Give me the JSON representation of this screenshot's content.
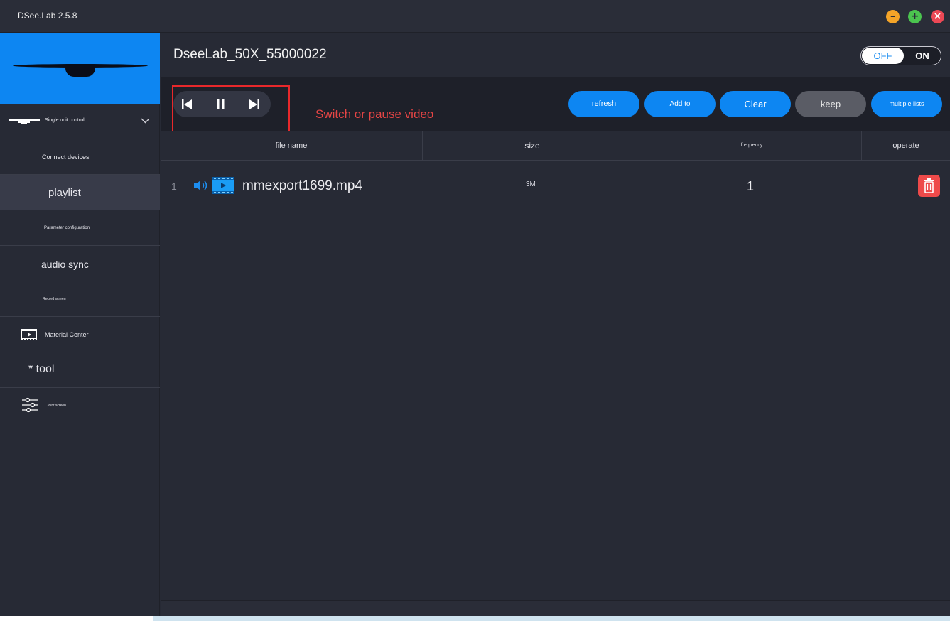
{
  "app": {
    "title": "DSee.Lab 2.5.8"
  },
  "window_controls": {
    "minimize_icon": "minimize-icon",
    "maximize_icon": "plus-icon",
    "close_icon": "close-icon"
  },
  "sidebar": {
    "section": {
      "label": "Single unit control",
      "icon": "monitor-icon",
      "chevron": "chevron-down-icon"
    },
    "items": [
      {
        "label": "Connect devices"
      },
      {
        "label": "playlist",
        "active": true
      },
      {
        "label": "Parameter configuration"
      },
      {
        "label": "audio sync"
      },
      {
        "label": "Record screen"
      },
      {
        "label": "Material Center",
        "icon": "film-icon"
      },
      {
        "label": "* tool"
      },
      {
        "label": "Joint screen",
        "icon": "sliders-icon"
      }
    ]
  },
  "header": {
    "device_name": "DseeLab_50X_55000022",
    "toggle": {
      "off_label": "OFF",
      "on_label": "ON",
      "state": "OFF"
    }
  },
  "toolbar": {
    "annotation": "Switch or pause video",
    "buttons": [
      {
        "label": "refresh"
      },
      {
        "label": "Add to"
      },
      {
        "label": "Clear"
      },
      {
        "label": "keep"
      },
      {
        "label": "multiple lists"
      }
    ]
  },
  "table": {
    "columns": [
      "file name",
      "size",
      "frequency",
      "operate"
    ],
    "rows": [
      {
        "index": "1",
        "file_name": "mmexport1699.mp4",
        "size": "3M",
        "frequency": "1",
        "icons": [
          "speaker-icon",
          "video-file-icon"
        ],
        "action_icon": "trash-icon"
      }
    ]
  },
  "colors": {
    "accent": "#0d86f2",
    "background": "#272a35",
    "danger": "#ee4a4a",
    "annotation": "#e8282b"
  }
}
